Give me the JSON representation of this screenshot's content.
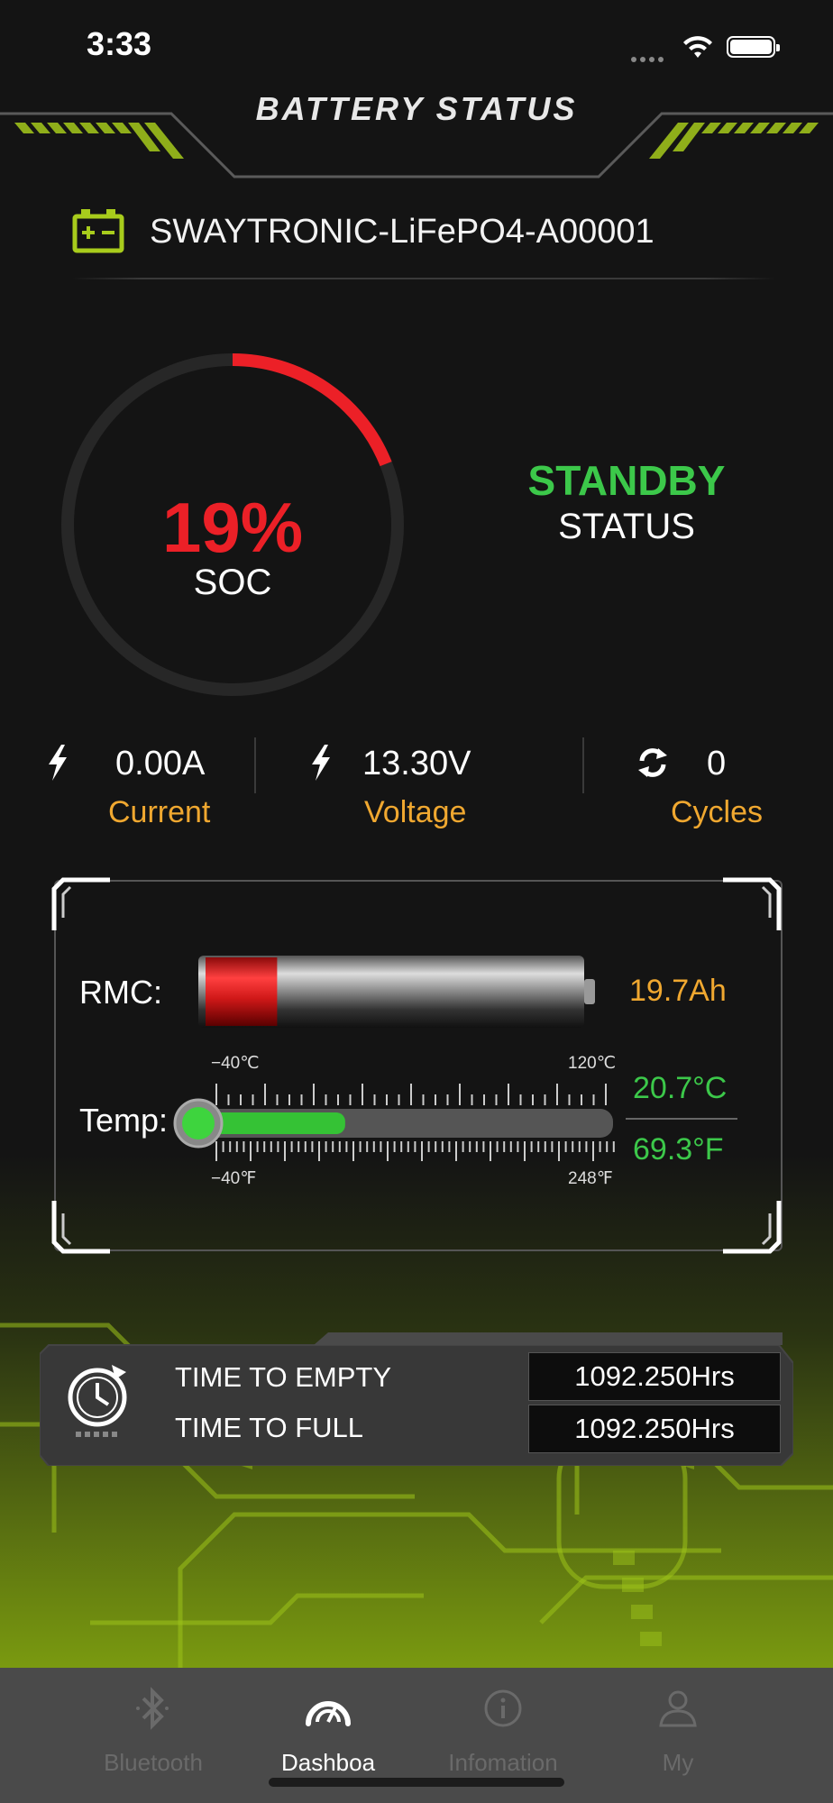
{
  "status_bar": {
    "time": "3:33"
  },
  "header": {
    "title": "BATTERY STATUS"
  },
  "device": {
    "name": "SWAYTRONIC-LiFePO4-A00001",
    "icon": "battery-plus-minus-icon"
  },
  "soc": {
    "value": "19%",
    "label": "SOC",
    "fraction": 0.19,
    "color": "#ec2027"
  },
  "state": {
    "value": "STANDBY",
    "label": "STATUS",
    "color": "#3cc84a"
  },
  "metrics": {
    "current": {
      "value": "0.00A",
      "label": "Current",
      "icon": "lightning-icon"
    },
    "voltage": {
      "value": "13.30V",
      "label": "Voltage",
      "icon": "lightning-icon"
    },
    "cycles": {
      "value": "0",
      "label": "Cycles",
      "icon": "refresh-icon"
    }
  },
  "rmc": {
    "label": "RMC:",
    "value": "19.7Ah",
    "level": 0.19
  },
  "temp": {
    "label": "Temp:",
    "celsius": "20.7°C",
    "fahrenheit": "69.3°F",
    "scale_c_min": "−40℃",
    "scale_c_max": "120℃",
    "scale_f_min": "−40℉",
    "scale_f_max": "248℉",
    "level": 0.38
  },
  "time_info": {
    "empty_label": "TIME TO EMPTY",
    "empty_value": "1092.250Hrs",
    "full_label": "TIME TO FULL",
    "full_value": "1092.250Hrs"
  },
  "tabs": [
    {
      "label": "Bluetooth",
      "icon": "bluetooth-icon",
      "active": false
    },
    {
      "label": "Dashboa",
      "icon": "gauge-icon",
      "active": true
    },
    {
      "label": "Infomation",
      "icon": "info-icon",
      "active": false
    },
    {
      "label": "My",
      "icon": "user-icon",
      "active": false
    }
  ],
  "colors": {
    "accent_green": "#3cc84a",
    "accent_orange": "#f0a830",
    "alert_red": "#ec2027",
    "lime": "#a8cc1c"
  }
}
